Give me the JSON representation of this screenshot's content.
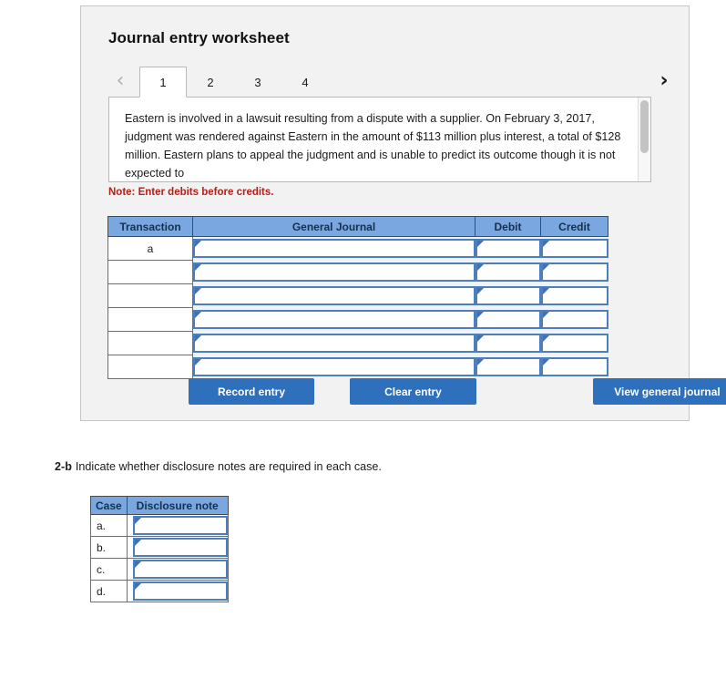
{
  "worksheet": {
    "title": "Journal entry worksheet",
    "nav": {
      "prev_icon": "chevron-left-icon",
      "prev_glyph": "‹",
      "next_icon": "chevron-right-icon",
      "next_glyph": "›"
    },
    "tabs": [
      {
        "label": "1",
        "active": true
      },
      {
        "label": "2",
        "active": false
      },
      {
        "label": "3",
        "active": false
      },
      {
        "label": "4",
        "active": false
      }
    ],
    "scenario_text": "Eastern is involved in a lawsuit resulting from a dispute with a supplier. On February 3, 2017, judgment was rendered against Eastern in the amount of $113 million plus interest, a total of $128 million. Eastern plans to appeal the judgment and is unable to predict its outcome though it is not expected to",
    "note": "Note: Enter debits before credits.",
    "journal": {
      "headers": [
        "Transaction",
        "General Journal",
        "Debit",
        "Credit"
      ],
      "rows": [
        {
          "transaction": "a",
          "general_journal": "",
          "debit": "",
          "credit": ""
        },
        {
          "transaction": "",
          "general_journal": "",
          "debit": "",
          "credit": ""
        },
        {
          "transaction": "",
          "general_journal": "",
          "debit": "",
          "credit": ""
        },
        {
          "transaction": "",
          "general_journal": "",
          "debit": "",
          "credit": ""
        },
        {
          "transaction": "",
          "general_journal": "",
          "debit": "",
          "credit": ""
        },
        {
          "transaction": "",
          "general_journal": "",
          "debit": "",
          "credit": ""
        }
      ]
    },
    "buttons": {
      "record": "Record entry",
      "clear": "Clear entry",
      "view": "View general journal"
    }
  },
  "part_2b": {
    "label": "2-b",
    "instruction": "Indicate whether disclosure notes are required in each case.",
    "table": {
      "headers": [
        "Case",
        "Disclosure note"
      ],
      "rows": [
        {
          "case": "a.",
          "disclosure_note": ""
        },
        {
          "case": "b.",
          "disclosure_note": ""
        },
        {
          "case": "c.",
          "disclosure_note": ""
        },
        {
          "case": "d.",
          "disclosure_note": ""
        }
      ]
    }
  },
  "colors": {
    "panel_background": "#f2f2f2",
    "table_header_blue": "#7aa7e0",
    "button_blue": "#2f70bd",
    "note_red": "#b52018",
    "input_border_blue": "#4e7fbd"
  }
}
